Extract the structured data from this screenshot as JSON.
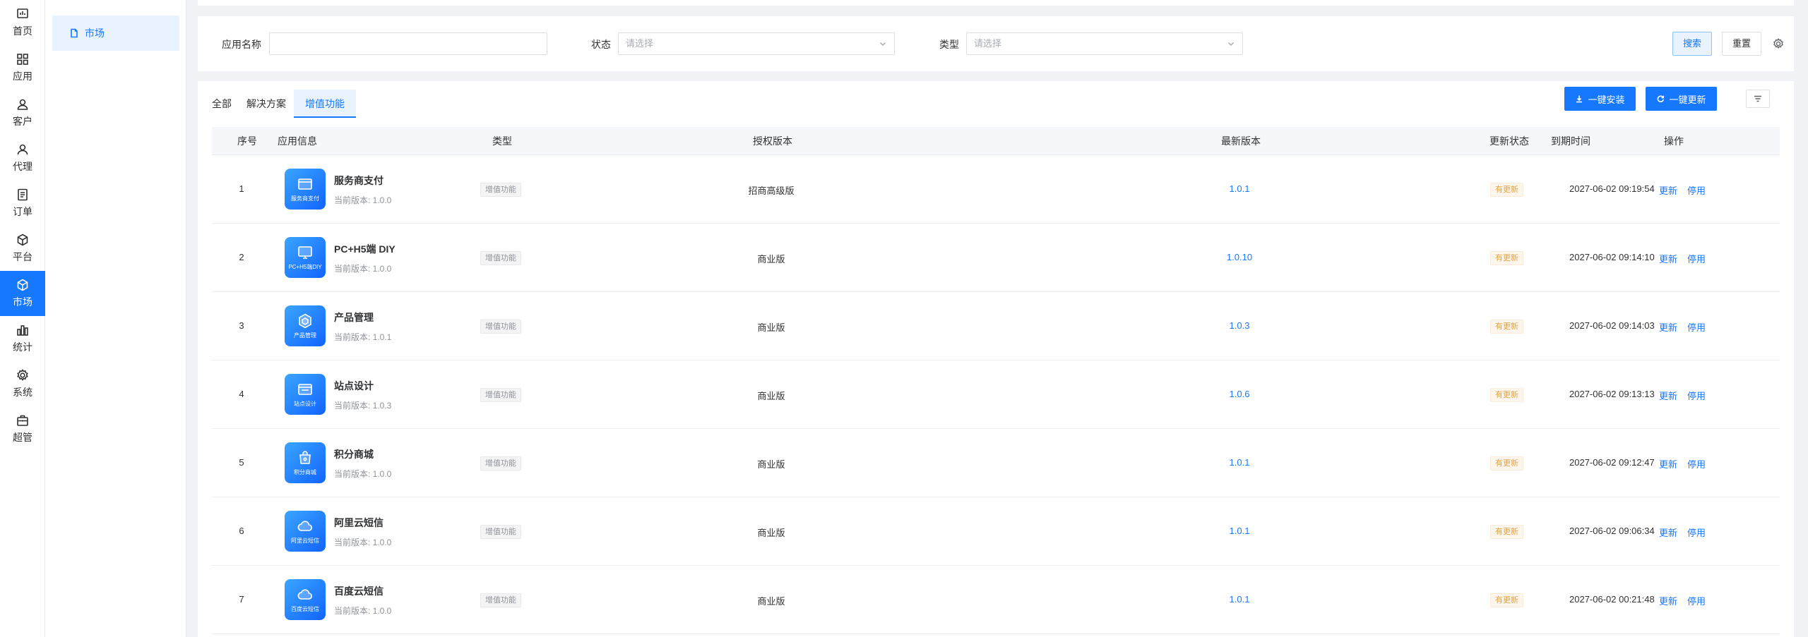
{
  "sidebar": {
    "items": [
      {
        "label": "首页",
        "icon": "dashboard-icon"
      },
      {
        "label": "应用",
        "icon": "apps-icon"
      },
      {
        "label": "客户",
        "icon": "user-icon"
      },
      {
        "label": "代理",
        "icon": "agent-icon"
      },
      {
        "label": "订单",
        "icon": "order-icon"
      },
      {
        "label": "平台",
        "icon": "platform-icon"
      },
      {
        "label": "市场",
        "icon": "market-icon",
        "active": true
      },
      {
        "label": "统计",
        "icon": "chart-icon"
      },
      {
        "label": "系统",
        "icon": "gear-icon"
      },
      {
        "label": "超管",
        "icon": "briefcase-icon"
      }
    ]
  },
  "submenu": {
    "label": "市场"
  },
  "filters": {
    "app_name_label": "应用名称",
    "app_name_value": "",
    "status_label": "状态",
    "status_placeholder": "请选择",
    "type_label": "类型",
    "type_placeholder": "请选择",
    "search_label": "搜索",
    "reset_label": "重置"
  },
  "tabs": [
    {
      "label": "全部"
    },
    {
      "label": "解决方案"
    },
    {
      "label": "增值功能",
      "active": true
    }
  ],
  "actions": {
    "install_all_label": "一键安装",
    "update_all_label": "一键更新"
  },
  "table": {
    "headers": {
      "index": "序号",
      "info": "应用信息",
      "type": "类型",
      "license": "授权版本",
      "latest": "最新版本",
      "update_status": "更新状态",
      "expire": "到期时间",
      "ops": "操作"
    },
    "rows": [
      {
        "index": "1",
        "name": "服务商支付",
        "icon_text": "服务商支付",
        "current": "当前版本: 1.0.0",
        "type": "增值功能",
        "license": "招商高级版",
        "latest": "1.0.1",
        "status": "有更新",
        "expire": "2027-06-02 09:19:54",
        "update": "更新",
        "disable": "停用"
      },
      {
        "index": "2",
        "name": "PC+H5端 DIY",
        "icon_text": "PC+H5端DIY",
        "current": "当前版本: 1.0.0",
        "type": "增值功能",
        "license": "商业版",
        "latest": "1.0.10",
        "status": "有更新",
        "expire": "2027-06-02 09:14:10",
        "update": "更新",
        "disable": "停用"
      },
      {
        "index": "3",
        "name": "产品管理",
        "icon_text": "产品管理",
        "current": "当前版本: 1.0.1",
        "type": "增值功能",
        "license": "商业版",
        "latest": "1.0.3",
        "status": "有更新",
        "expire": "2027-06-02 09:14:03",
        "update": "更新",
        "disable": "停用"
      },
      {
        "index": "4",
        "name": "站点设计",
        "icon_text": "站点设计",
        "current": "当前版本: 1.0.3",
        "type": "增值功能",
        "license": "商业版",
        "latest": "1.0.6",
        "status": "有更新",
        "expire": "2027-06-02 09:13:13",
        "update": "更新",
        "disable": "停用"
      },
      {
        "index": "5",
        "name": "积分商城",
        "icon_text": "积分商城",
        "current": "当前版本: 1.0.0",
        "type": "增值功能",
        "license": "商业版",
        "latest": "1.0.1",
        "status": "有更新",
        "expire": "2027-06-02 09:12:47",
        "update": "更新",
        "disable": "停用"
      },
      {
        "index": "6",
        "name": "阿里云短信",
        "icon_text": "阿里云短信",
        "current": "当前版本: 1.0.0",
        "type": "增值功能",
        "license": "商业版",
        "latest": "1.0.1",
        "status": "有更新",
        "expire": "2027-06-02 09:06:34",
        "update": "更新",
        "disable": "停用"
      },
      {
        "index": "7",
        "name": "百度云短信",
        "icon_text": "百度云短信",
        "current": "当前版本: 1.0.0",
        "type": "增值功能",
        "license": "商业版",
        "latest": "1.0.1",
        "status": "有更新",
        "expire": "2027-06-02 00:21:48",
        "update": "更新",
        "disable": "停用"
      }
    ]
  },
  "colors": {
    "primary": "#1677ff",
    "warning": "#e6a23c"
  }
}
